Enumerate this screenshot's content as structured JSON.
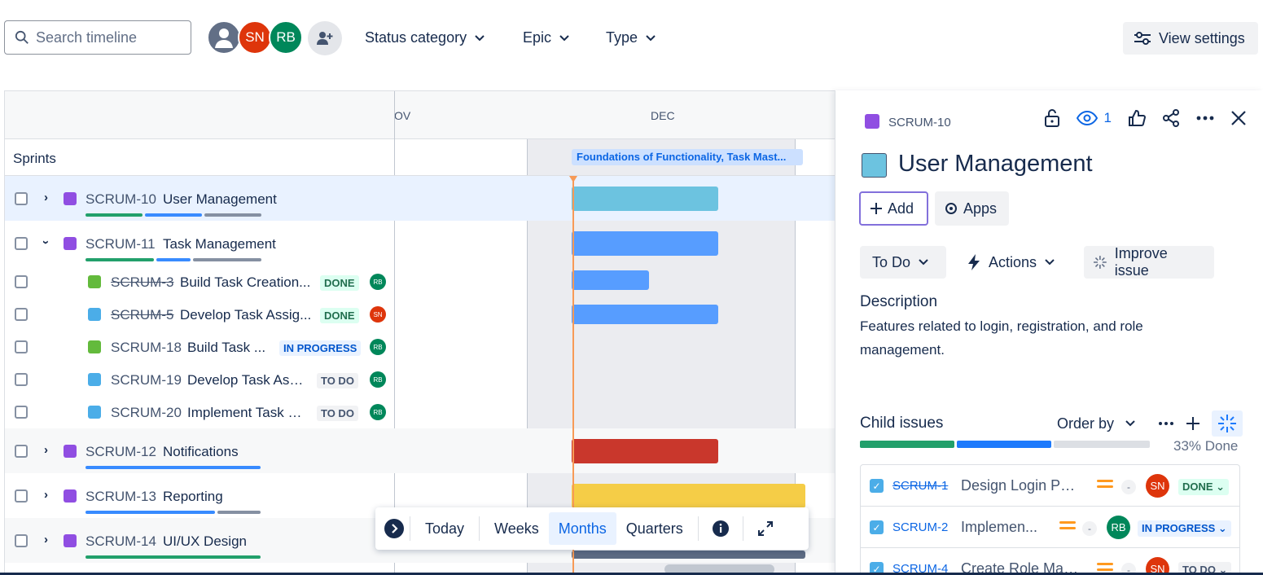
{
  "toolbar": {
    "search_placeholder": "Search timeline",
    "avatars": [
      "",
      "SN",
      "RB"
    ],
    "filters": [
      "Status category",
      "Epic",
      "Type"
    ],
    "view_settings": "View settings"
  },
  "timeline": {
    "months": [
      "OV",
      "DEC"
    ],
    "sprints_label": "Sprints",
    "sprint_chip": "Foundations of Functionality, Task Mast...",
    "rows": [
      {
        "key": "SCRUM-10",
        "title": "User Management"
      },
      {
        "key": "SCRUM-11",
        "title": "Task Management"
      },
      {
        "key": "SCRUM-3",
        "title": "Build Task Creation...",
        "status": "DONE",
        "assignee": "RB"
      },
      {
        "key": "SCRUM-5",
        "title": "Develop Task Assig...",
        "status": "DONE",
        "assignee": "SN"
      },
      {
        "key": "SCRUM-18",
        "title": "Build Task ...",
        "status": "IN PROGRESS",
        "assignee": "RB"
      },
      {
        "key": "SCRUM-19",
        "title": "Develop Task Ass...",
        "status": "TO DO",
        "assignee": "RB"
      },
      {
        "key": "SCRUM-20",
        "title": "Implement Task S...",
        "status": "TO DO",
        "assignee": "RB"
      },
      {
        "key": "SCRUM-12",
        "title": "Notifications"
      },
      {
        "key": "SCRUM-13",
        "title": "Reporting"
      },
      {
        "key": "SCRUM-14",
        "title": "UI/UX Design"
      }
    ],
    "bar_colors": {
      "user_mgmt": "#6cc3e0",
      "task": "#579dff",
      "notifications": "#c9372c",
      "reporting": "#f5cd47",
      "today": "#f79a56"
    }
  },
  "zoom": {
    "today": "Today",
    "weeks": "Weeks",
    "months": "Months",
    "quarters": "Quarters"
  },
  "panel": {
    "key": "SCRUM-10",
    "watchers": "1",
    "title": "User Management",
    "add": "Add",
    "apps": "Apps",
    "status": "To Do",
    "actions": "Actions",
    "improve": "Improve issue",
    "description_label": "Description",
    "description": "Features related to login, registration, and role management.",
    "child_issues_label": "Child issues",
    "order_by": "Order by",
    "done_pct": "33% Done",
    "children": [
      {
        "key": "SCRUM-1",
        "title": "Design Login Page",
        "assignee": "SN",
        "status": "DONE"
      },
      {
        "key": "SCRUM-2",
        "title": "Implemen...",
        "assignee": "RB",
        "status": "IN PROGRESS"
      },
      {
        "key": "SCRUM-4",
        "title": "Create Role Man...",
        "assignee": "SN",
        "status": "TO DO"
      }
    ]
  }
}
